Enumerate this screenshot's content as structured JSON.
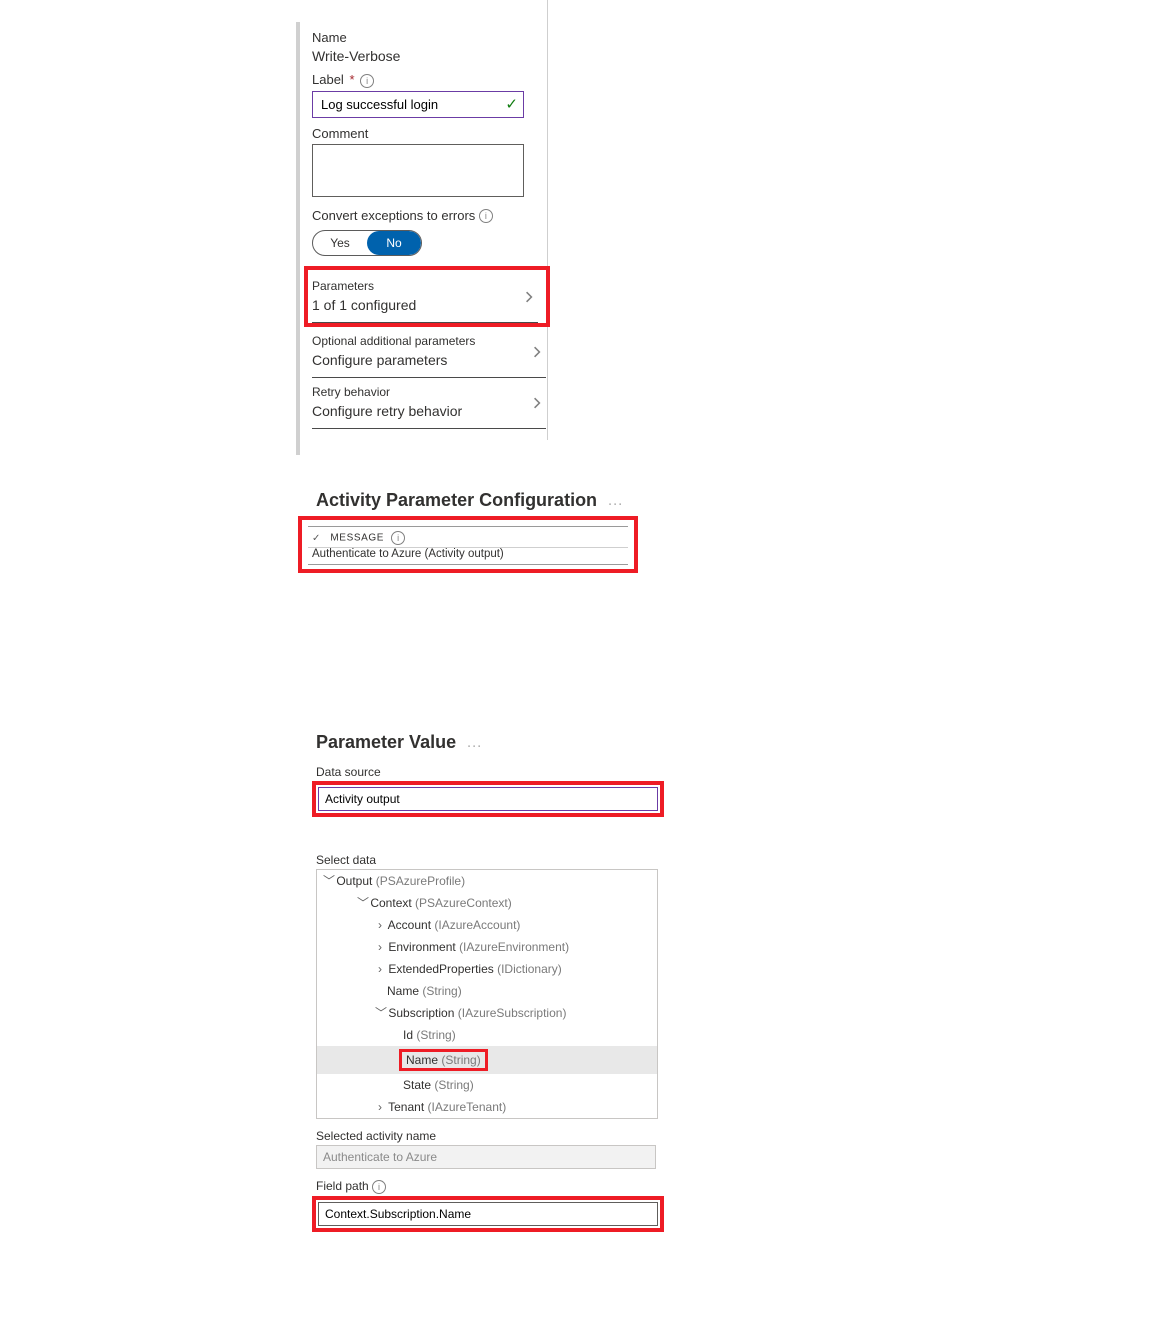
{
  "activity": {
    "name_label": "Name",
    "name_value": "Write-Verbose",
    "label_label": "Label",
    "label_value": "Log successful login",
    "comment_label": "Comment",
    "comment_value": "",
    "convert_label": "Convert exceptions to errors",
    "toggle_yes": "Yes",
    "toggle_no": "No",
    "parameters": {
      "title": "Parameters",
      "value": "1 of 1 configured"
    },
    "optional": {
      "title": "Optional additional parameters",
      "value": "Configure parameters"
    },
    "retry": {
      "title": "Retry behavior",
      "value": "Configure retry behavior"
    }
  },
  "paramcfg": {
    "title": "Activity Parameter Configuration",
    "message_lbl": "MESSAGE",
    "value": "Authenticate to Azure (Activity output)"
  },
  "paramval": {
    "title": "Parameter Value",
    "datasource_label": "Data source",
    "datasource_value": "Activity output",
    "selectdata_label": "Select data",
    "tree": {
      "output": "Output",
      "output_t": "(PSAzureProfile)",
      "context": "Context",
      "context_t": "(PSAzureContext)",
      "account": "Account",
      "account_t": "(IAzureAccount)",
      "environment": "Environment",
      "environment_t": "(IAzureEnvironment)",
      "extprops": "ExtendedProperties",
      "extprops_t": "(IDictionary)",
      "ctxname": "Name",
      "ctxname_t": "(String)",
      "subscription": "Subscription",
      "subscription_t": "(IAzureSubscription)",
      "id": "Id",
      "id_t": "(String)",
      "name": "Name",
      "name_t": "(String)",
      "state": "State",
      "state_t": "(String)",
      "tenant": "Tenant",
      "tenant_t": "(IAzureTenant)"
    },
    "selected_activity_label": "Selected activity name",
    "selected_activity_value": "Authenticate to Azure",
    "fieldpath_label": "Field path",
    "fieldpath_value": "Context.Subscription.Name"
  }
}
